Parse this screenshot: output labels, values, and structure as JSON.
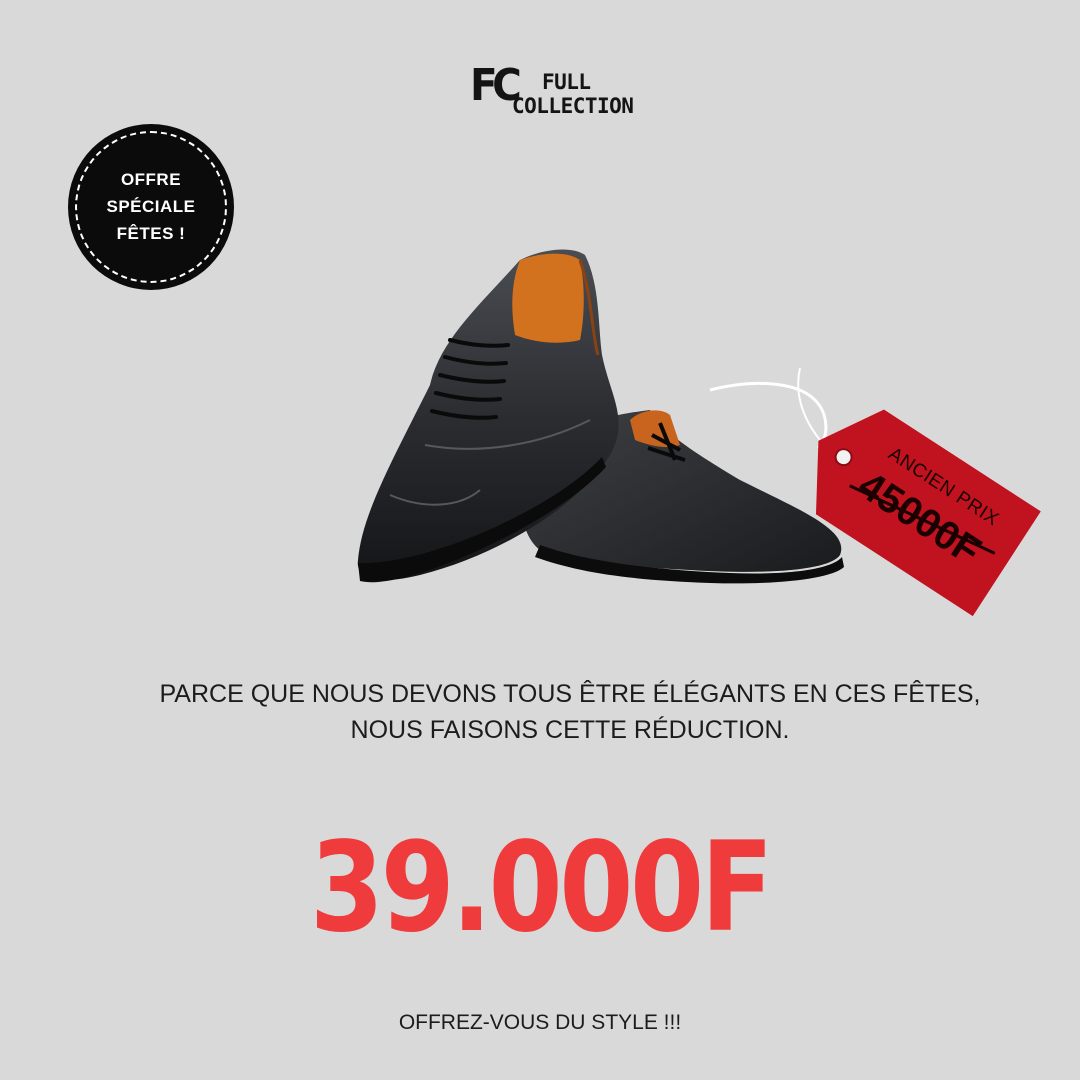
{
  "brand": {
    "mark": "FC",
    "line1": "FULL",
    "line2": "COLLECTION"
  },
  "badge": {
    "lines": [
      "OFFRE",
      "SPÉCIALE",
      "FÊTES !"
    ]
  },
  "price_tag": {
    "label": "ANCIEN PRIX",
    "old_price": "45000F",
    "color": "#c1121f"
  },
  "tagline": {
    "line1": "PARCE QUE NOUS DEVONS TOUS ÊTRE ÉLÉGANTS EN CES FÊTES,",
    "line2": "NOUS FAISONS CETTE RÉDUCTION."
  },
  "price": {
    "value": "39.000F",
    "color": "#ef3b3b"
  },
  "slogan": "OFFREZ-VOUS DU STYLE  !!!",
  "icons": {
    "product": "oxford-shoes-icon"
  }
}
